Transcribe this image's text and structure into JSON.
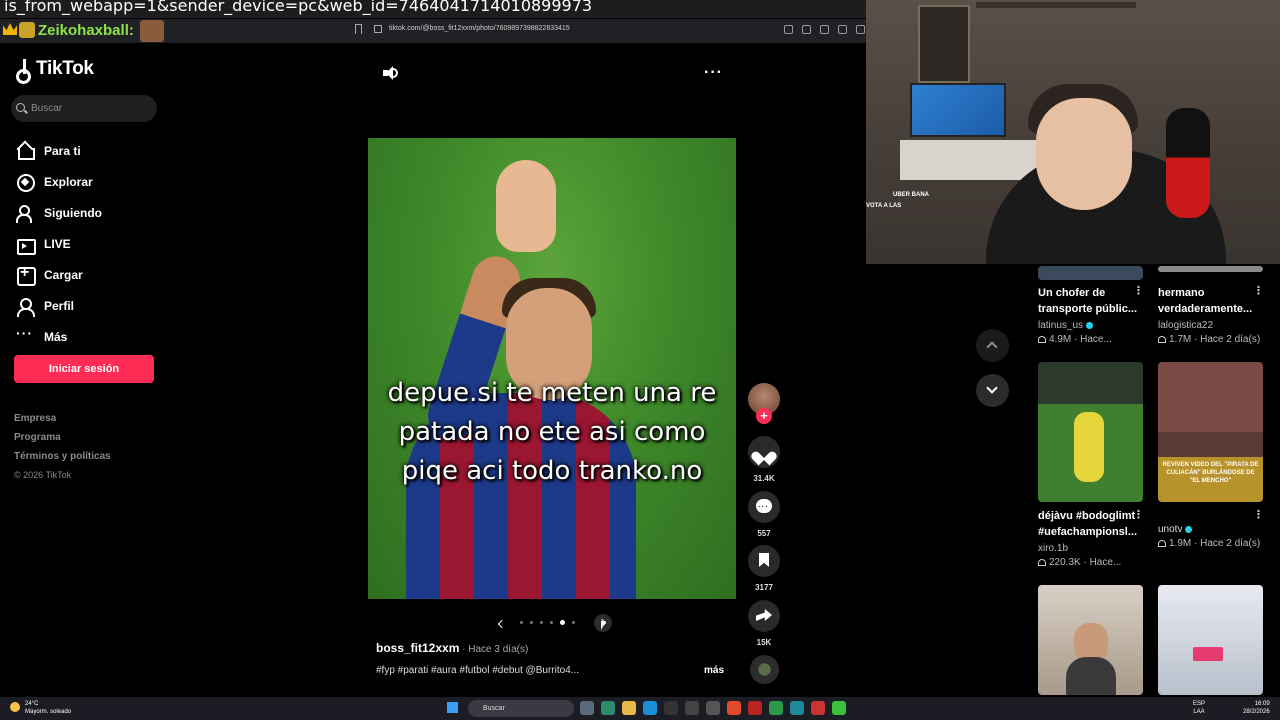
{
  "overlay": {
    "url_fragment": "is_from_webapp=1&sender_device=pc&web_id=7464041714010899973",
    "chat_user": "Zeikohaxball:"
  },
  "browser": {
    "address": "tiktok.com/@boss_fit12xxm/photo/7609897398822833415"
  },
  "sidebar": {
    "logo": "TikTok",
    "search_placeholder": "Buscar",
    "nav": [
      {
        "label": "Para ti",
        "icon": "home-icon"
      },
      {
        "label": "Explorar",
        "icon": "compass-icon"
      },
      {
        "label": "Siguiendo",
        "icon": "following-icon"
      },
      {
        "label": "LIVE",
        "icon": "live-icon"
      },
      {
        "label": "Cargar",
        "icon": "upload-icon"
      },
      {
        "label": "Perfil",
        "icon": "profile-icon"
      },
      {
        "label": "Más",
        "icon": "more-icon"
      }
    ],
    "login_label": "Iniciar sesión",
    "footer": [
      "Empresa",
      "Programa",
      "Términos y políticas",
      "© 2026 TikTok"
    ]
  },
  "post": {
    "caption_lines": [
      "depue.si te meten una re",
      "patada no ete asi como",
      "piqe aci todo tranko.no"
    ],
    "author": "boss_fit12xxm",
    "time": " · Hace 3 día(s)",
    "tags": "#fyp #parati #aura #futbol #debut @Burrito4...",
    "more_label": "más",
    "likes": "31.4K",
    "comments": "557",
    "saves": "3177",
    "shares": "15K",
    "carousel": {
      "total": 6,
      "current": 5
    }
  },
  "webcam": {
    "chat_lines": [
      "UBER BANA",
      "VOTA A LAS"
    ]
  },
  "grid": [
    {
      "title1": "Un chofer de",
      "title2": "transporte públic...",
      "author": "latinus_us",
      "verified": true,
      "stats": "4.9M · Hace..."
    },
    {
      "title1": "hermano",
      "title2": "verdaderamente...",
      "author": "lalogistica22",
      "verified": false,
      "stats": "1.7M · Hace 2 día(s)"
    },
    {
      "title1": "déjàvu #bodoglimt",
      "title2": "#uefachampionsl...",
      "author": "xiro.1b",
      "verified": false,
      "stats": "220.3K · Hace..."
    },
    {
      "title1": "",
      "title2": "",
      "author": "unotv",
      "verified": true,
      "stats": "1.9M · Hace 2 día(s)",
      "thumb_text": "REVIVEN VIDEO DEL \"PIRATA DE CULIACÁN\" BURLÁNDOSE DE \"EL MENCHO\""
    }
  ],
  "taskbar": {
    "temp": "24°C",
    "weather": "Mayorm. soleado",
    "search": "Buscar",
    "lang1": "ESP",
    "lang2": "LAA",
    "time": "16:09",
    "date": "28/2/2026"
  }
}
